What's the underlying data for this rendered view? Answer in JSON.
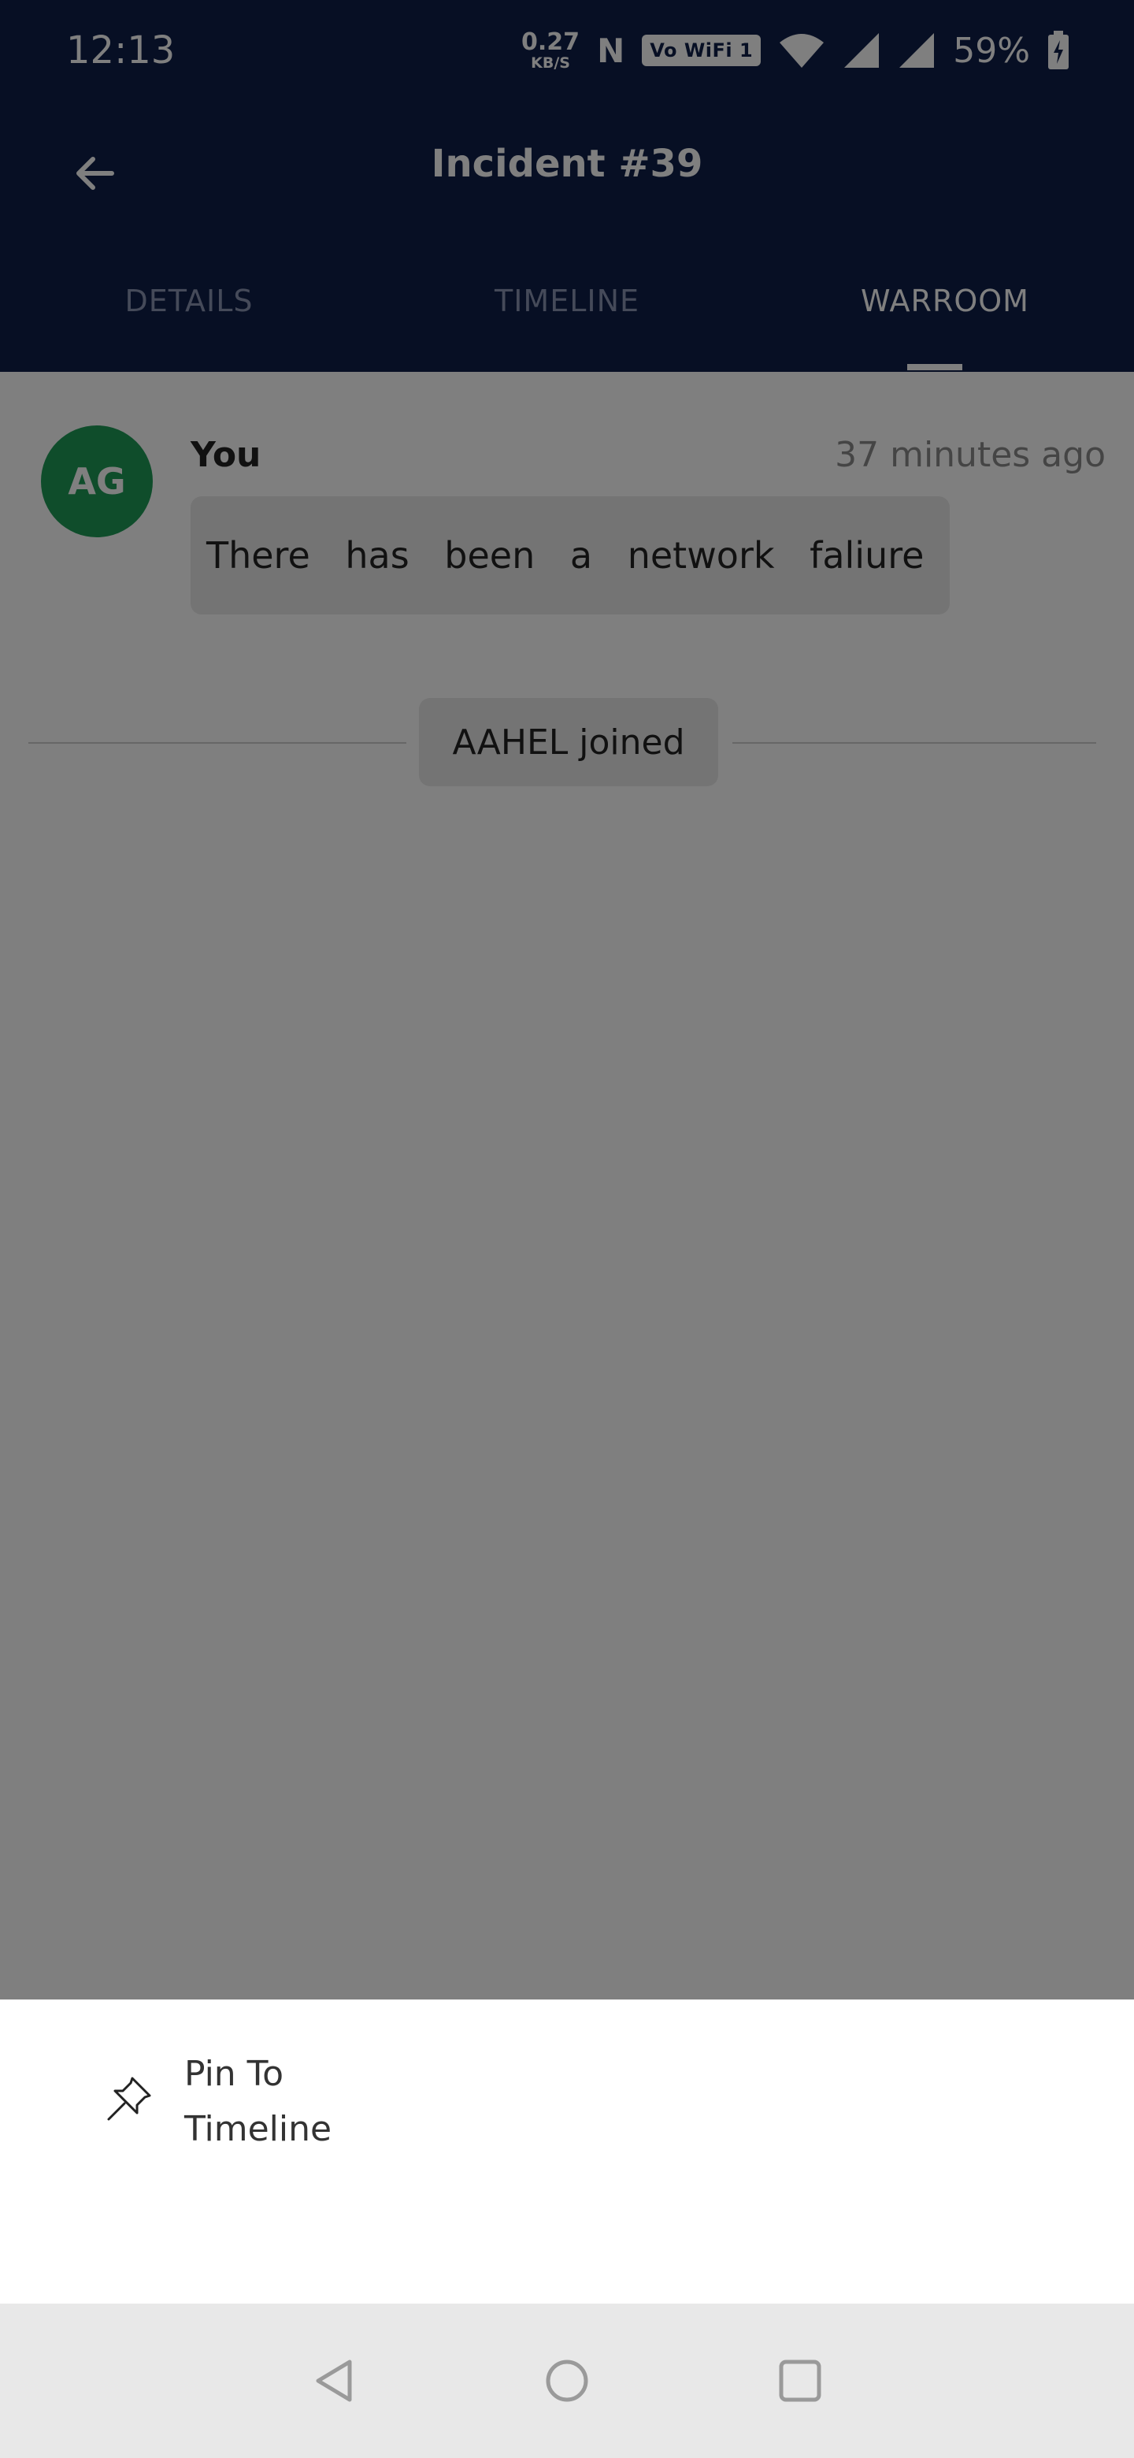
{
  "status_bar": {
    "time": "12:13",
    "net_speed_value": "0.27",
    "net_speed_unit": "KB/S",
    "nfc": "N",
    "wifi_label": "Vo WiFi 1",
    "battery": "59%"
  },
  "header": {
    "title": "Incident #39"
  },
  "tabs": [
    {
      "label": "DETAILS",
      "active": false
    },
    {
      "label": "TIMELINE",
      "active": false
    },
    {
      "label": "WARROOM",
      "active": true
    }
  ],
  "messages": [
    {
      "avatar_initials": "AG",
      "author": "You",
      "time": "37 minutes ago",
      "text": "There has been a network faliure"
    }
  ],
  "system_event": {
    "text": "AAHEL joined"
  },
  "bottom_sheet": {
    "items": [
      {
        "icon": "pin-icon",
        "label": "Pin To Timeline"
      }
    ]
  },
  "colors": {
    "header_bg": "#0f1f48",
    "avatar_bg": "#1e9a57",
    "overlay": "rgba(0,0,0,0.5)"
  }
}
